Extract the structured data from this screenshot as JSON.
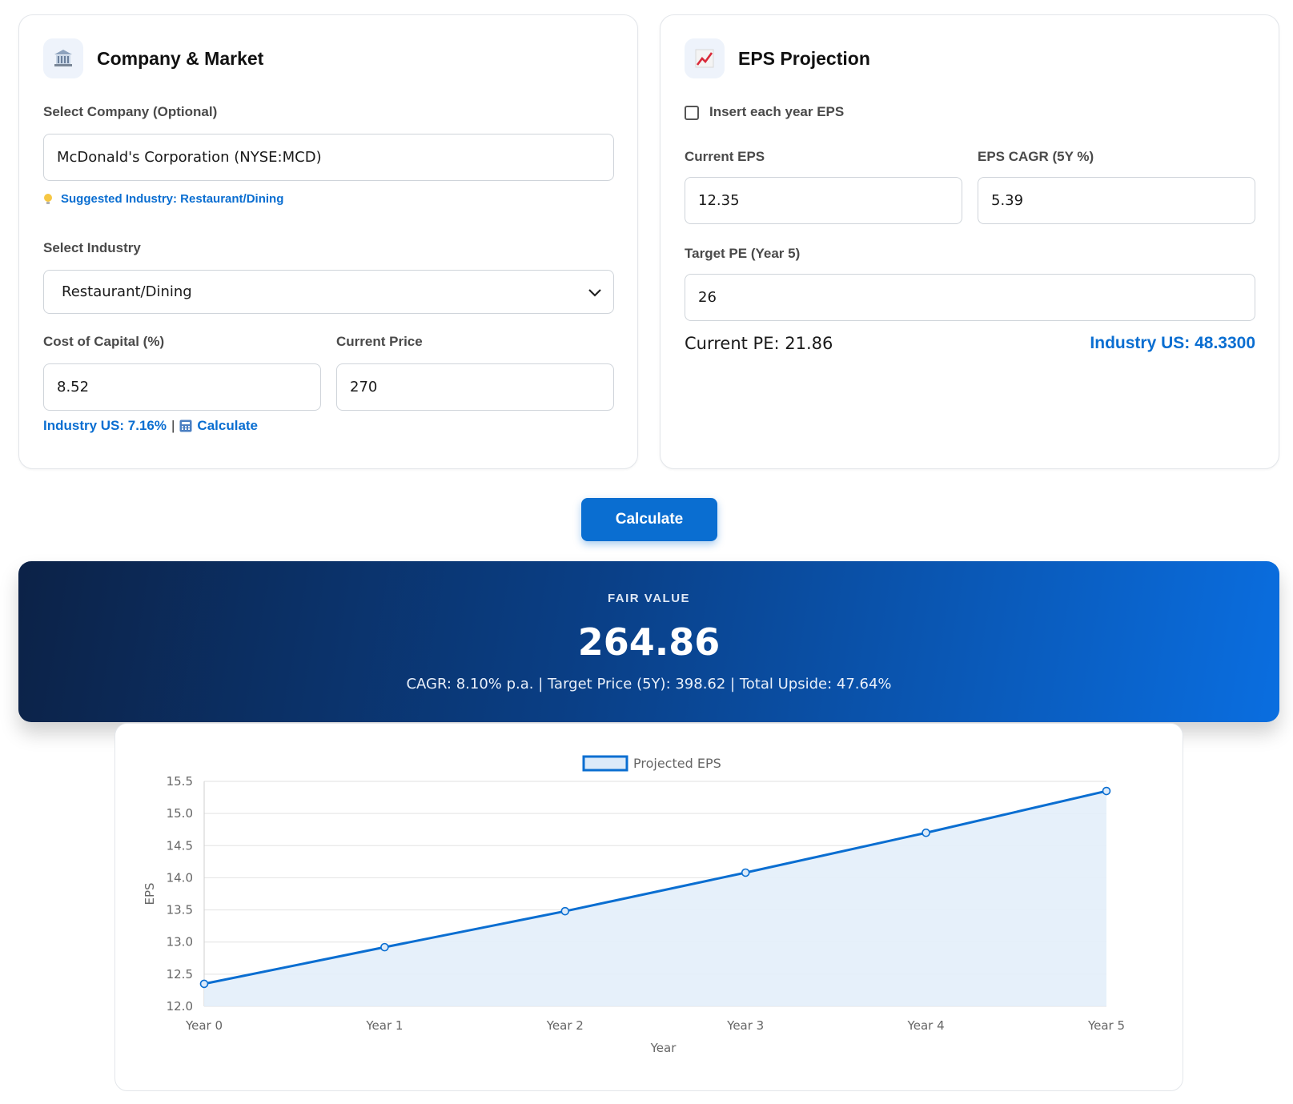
{
  "company_card": {
    "title": "Company & Market",
    "icon": "bank-building-icon",
    "select_company_label": "Select Company (Optional)",
    "company_value": "McDonald's Corporation (NYSE:MCD)",
    "suggested_industry": "Suggested Industry: Restaurant/Dining",
    "select_industry_label": "Select Industry",
    "industry_value": "Restaurant/Dining",
    "cost_of_capital_label": "Cost of Capital (%)",
    "cost_of_capital_value": "8.52",
    "current_price_label": "Current Price",
    "current_price_value": "270",
    "industry_us_text": "Industry US: 7.16%",
    "separator": "|",
    "calculate_link": "Calculate"
  },
  "eps_card": {
    "title": "EPS Projection",
    "icon": "chart-increasing-icon",
    "insert_each_year_label": "Insert each year EPS",
    "insert_each_year_checked": false,
    "current_eps_label": "Current EPS",
    "current_eps_value": "12.35",
    "eps_cagr_label": "EPS CAGR (5Y %)",
    "eps_cagr_value": "5.39",
    "target_pe_label": "Target PE (Year 5)",
    "target_pe_value": "26",
    "current_pe_text": "Current PE: 21.86",
    "industry_us_text": "Industry US: 48.3300"
  },
  "calculate_button": "Calculate",
  "fair_value": {
    "label": "FAIR VALUE",
    "value": "264.86",
    "summary": "CAGR: 8.10% p.a. | Target Price (5Y): 398.62 | Total Upside: 47.64%"
  },
  "colors": {
    "accent": "#0a6ed1",
    "line": "#0a6ed1",
    "fill": "#e3eefa"
  },
  "chart_data": {
    "type": "line",
    "categories": [
      "Year 0",
      "Year 1",
      "Year 2",
      "Year 3",
      "Year 4",
      "Year 5"
    ],
    "series": [
      {
        "name": "Projected EPS",
        "values": [
          12.35,
          12.92,
          13.48,
          14.08,
          14.7,
          15.35
        ]
      }
    ],
    "xlabel": "Year",
    "ylabel": "EPS",
    "ylim": [
      12.0,
      15.5
    ],
    "yticks": [
      "12.0",
      "12.5",
      "13.0",
      "13.5",
      "14.0",
      "14.5",
      "15.0",
      "15.5"
    ],
    "fill_area": true,
    "grid": true,
    "legend_position": "top-center"
  }
}
